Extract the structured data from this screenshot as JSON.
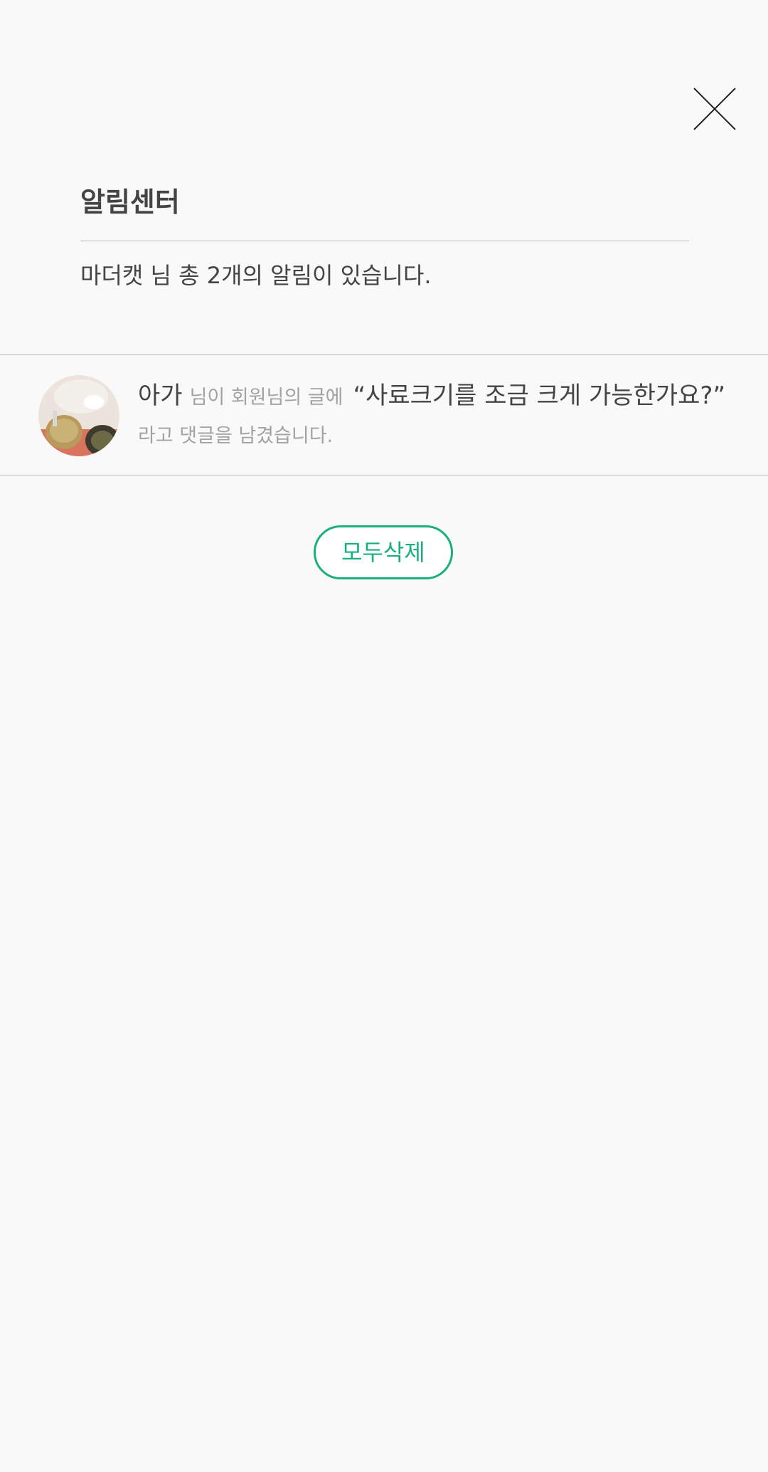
{
  "header": {
    "title": "알림센터",
    "summary": "마더캣 님 총 2개의 알림이 있습니다."
  },
  "notifications": [
    {
      "author": "아가",
      "action": "님이 회원님의 글에",
      "quote": "“사료크기를 조금 크게 가능한가요?”",
      "suffix": "라고 댓글을 남겼습니다."
    }
  ],
  "actions": {
    "delete_all_label": "모두삭제"
  },
  "colors": {
    "accent": "#19b07e",
    "text_primary": "#444444",
    "text_secondary": "#a2a2a2",
    "divider": "#bdbdbd",
    "background": "#f9f9f9"
  },
  "icons": {
    "close": "close-icon"
  }
}
